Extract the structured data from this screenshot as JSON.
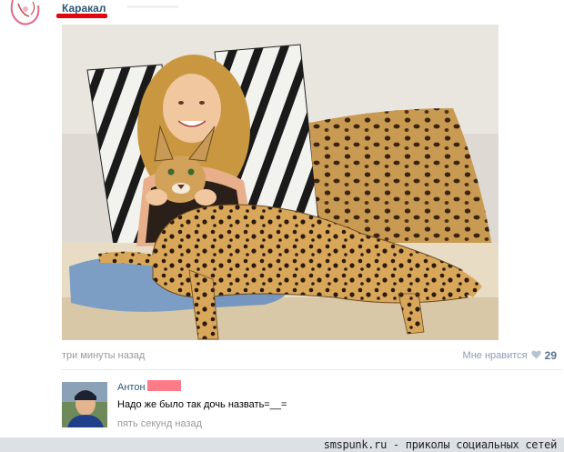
{
  "post": {
    "title": "Каракал",
    "time": "три минуты назад",
    "like_label": "Мне нравится",
    "like_count": "29"
  },
  "comment": {
    "author": "Антон",
    "text": "Надо же было так дочь назвать=__=",
    "time": "пять секунд назад"
  },
  "footer": {
    "text": "smspunk.ru - приколы социальных сетей"
  },
  "icons": {
    "like": "heart-icon",
    "post_avatar": "avatar-drawing",
    "comment_avatar": "user-avatar"
  },
  "colors": {
    "link": "#2b587a",
    "meta": "#999999",
    "highlight": "#e3050d",
    "footer_bg": "#dde1e6"
  }
}
